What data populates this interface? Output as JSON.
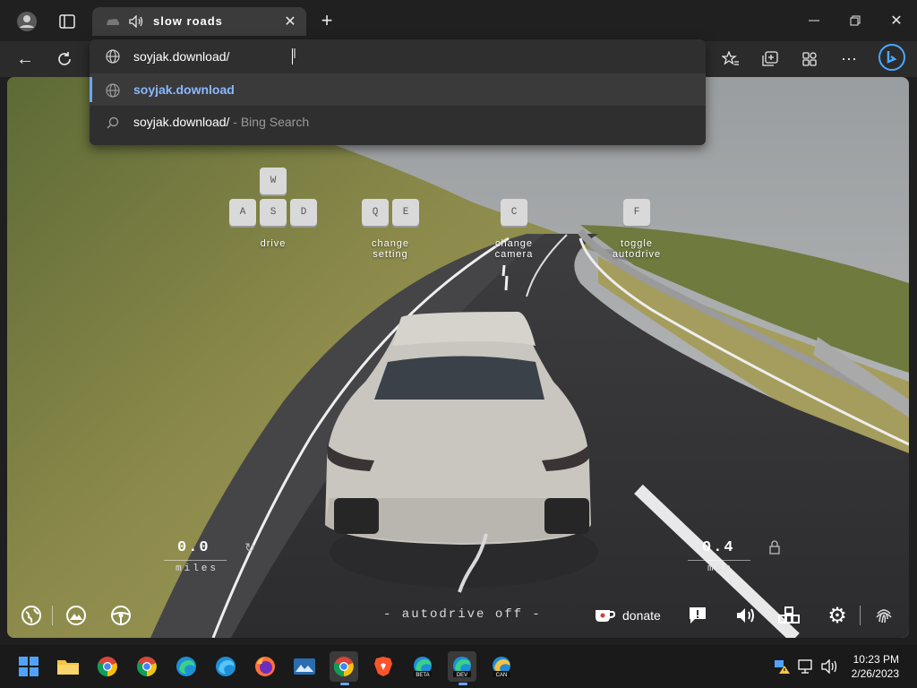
{
  "browser": {
    "tab_title": "slow roads",
    "address_value": "soyjak.download/",
    "suggestions": [
      {
        "text": "soyjak.download",
        "suffix": ""
      },
      {
        "text": "soyjak.download/",
        "suffix": " - Bing Search"
      }
    ]
  },
  "game": {
    "controls": [
      {
        "keys": [
          "W",
          "A",
          "S",
          "D"
        ],
        "label": "drive"
      },
      {
        "keys": [
          "Q",
          "E"
        ],
        "label_line1": "change",
        "label_line2": "setting"
      },
      {
        "keys": [
          "C"
        ],
        "label_line1": "change",
        "label_line2": "camera"
      },
      {
        "keys": [
          "F"
        ],
        "label_line1": "toggle",
        "label_line2": "autodrive"
      }
    ],
    "distance": {
      "value": "0.0",
      "unit": "miles"
    },
    "speed": {
      "value": "0.4",
      "unit": "mph"
    },
    "autodrive_status": "- autodrive off -",
    "donate_label": "donate"
  },
  "taskbar": {
    "time": "10:23 PM",
    "date": "2/26/2023",
    "badges": {
      "beta": "BETA",
      "dev": "DEV",
      "can": "CAN"
    }
  },
  "colors": {
    "accent": "#6aa6f5",
    "taskbar": "#1a1a1a",
    "browser_bg": "#202020"
  }
}
